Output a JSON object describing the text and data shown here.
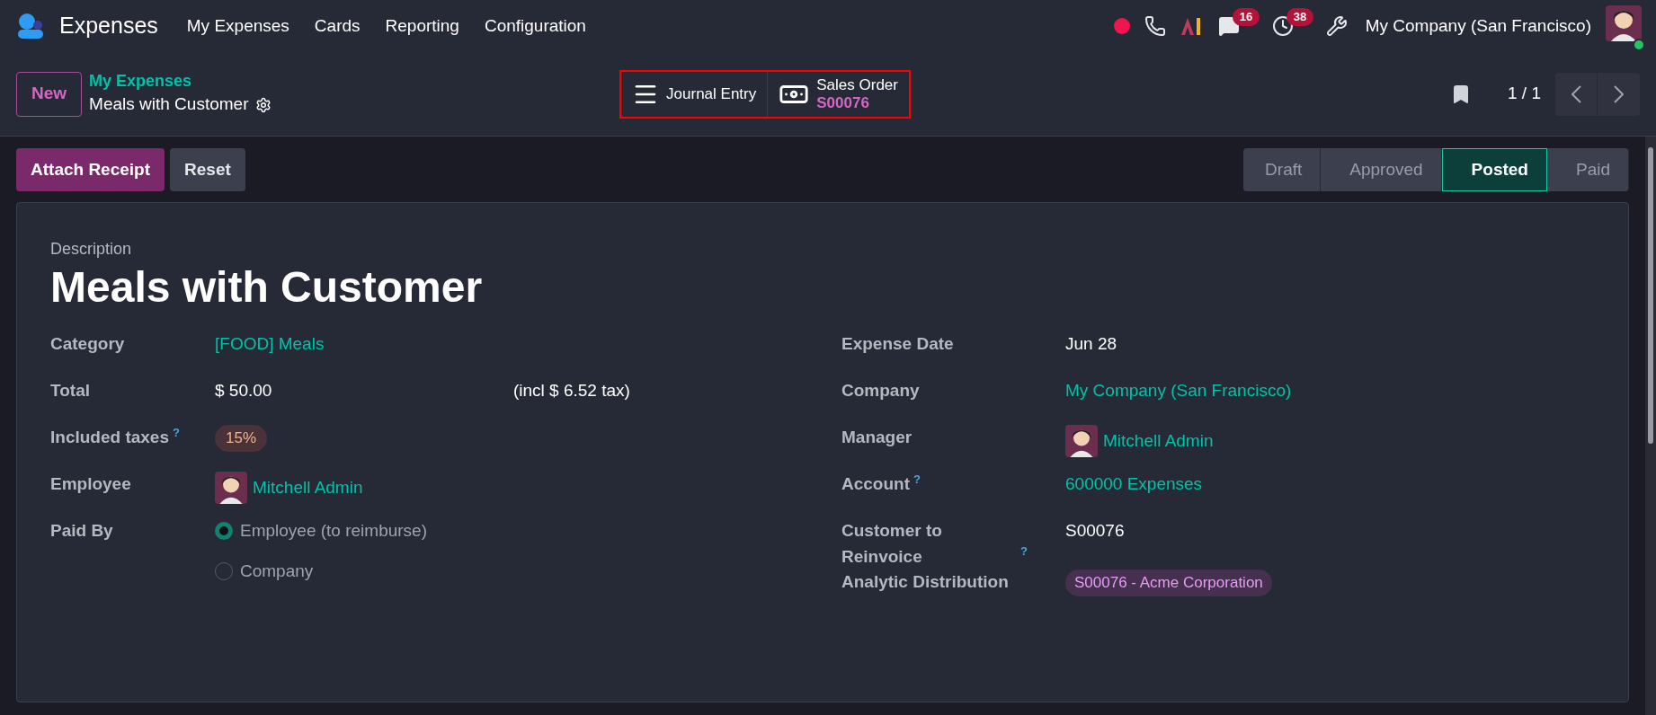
{
  "navbar": {
    "app_name": "Expenses",
    "menu": [
      {
        "label": "My Expenses"
      },
      {
        "label": "Cards"
      },
      {
        "label": "Reporting"
      },
      {
        "label": "Configuration"
      }
    ],
    "systray": [
      {
        "kind": "record"
      },
      {
        "kind": "phone"
      },
      {
        "kind": "ai"
      },
      {
        "kind": "chat",
        "badge": "16"
      },
      {
        "kind": "activity",
        "badge": "38"
      },
      {
        "kind": "tools"
      }
    ],
    "company": "My Company (San Francisco)"
  },
  "control_panel": {
    "new_button": "New",
    "breadcrumb_parent": "My Expenses",
    "breadcrumb_current": "Meals with Customer",
    "smart_buttons": [
      {
        "kind": "journal",
        "label": "Journal Entry"
      },
      {
        "kind": "money",
        "label": "Sales Order",
        "value": "S00076"
      }
    ],
    "pager": "1 / 1"
  },
  "actions": [
    {
      "label": "Attach Receipt",
      "kind": "primary"
    },
    {
      "label": "Reset",
      "kind": "secondary"
    }
  ],
  "stages": [
    {
      "label": "Draft",
      "selected": false
    },
    {
      "label": "Approved",
      "selected": false
    },
    {
      "label": "Posted",
      "selected": true
    },
    {
      "label": "Paid",
      "selected": false
    }
  ],
  "form": {
    "description_label": "Description",
    "title": "Meals with Customer",
    "left_fields": [
      {
        "label": "Category",
        "kind": "link",
        "value": "[FOOD] Meals"
      },
      {
        "label": "Total",
        "kind": "amount",
        "value": "$ 50.00",
        "note": "(incl $ 6.52 tax)"
      },
      {
        "label": "Included taxes",
        "help": "?",
        "kind": "tag",
        "value": "15%"
      },
      {
        "label": "Employee",
        "kind": "user",
        "value": "Mitchell Admin"
      },
      {
        "label": "Paid By",
        "kind": "radio",
        "options": [
          {
            "label": "Employee (to reimburse)",
            "selected": true
          },
          {
            "label": "Company",
            "selected": false
          }
        ]
      }
    ],
    "right_fields": [
      {
        "label": "Expense Date",
        "kind": "text",
        "value": "Jun 28"
      },
      {
        "label": "Company",
        "kind": "link",
        "value": "My Company (San Francisco)"
      },
      {
        "label": "Manager",
        "kind": "user",
        "value": "Mitchell Admin"
      },
      {
        "label": "Account",
        "help": "?",
        "kind": "link",
        "value": "600000 Expenses"
      },
      {
        "label": "Customer to Reinvoice",
        "help": "?",
        "kind": "text",
        "value": "S00076"
      },
      {
        "label": "Analytic Distribution",
        "kind": "analytic",
        "value": "S00076 - Acme Corporation"
      }
    ]
  }
}
